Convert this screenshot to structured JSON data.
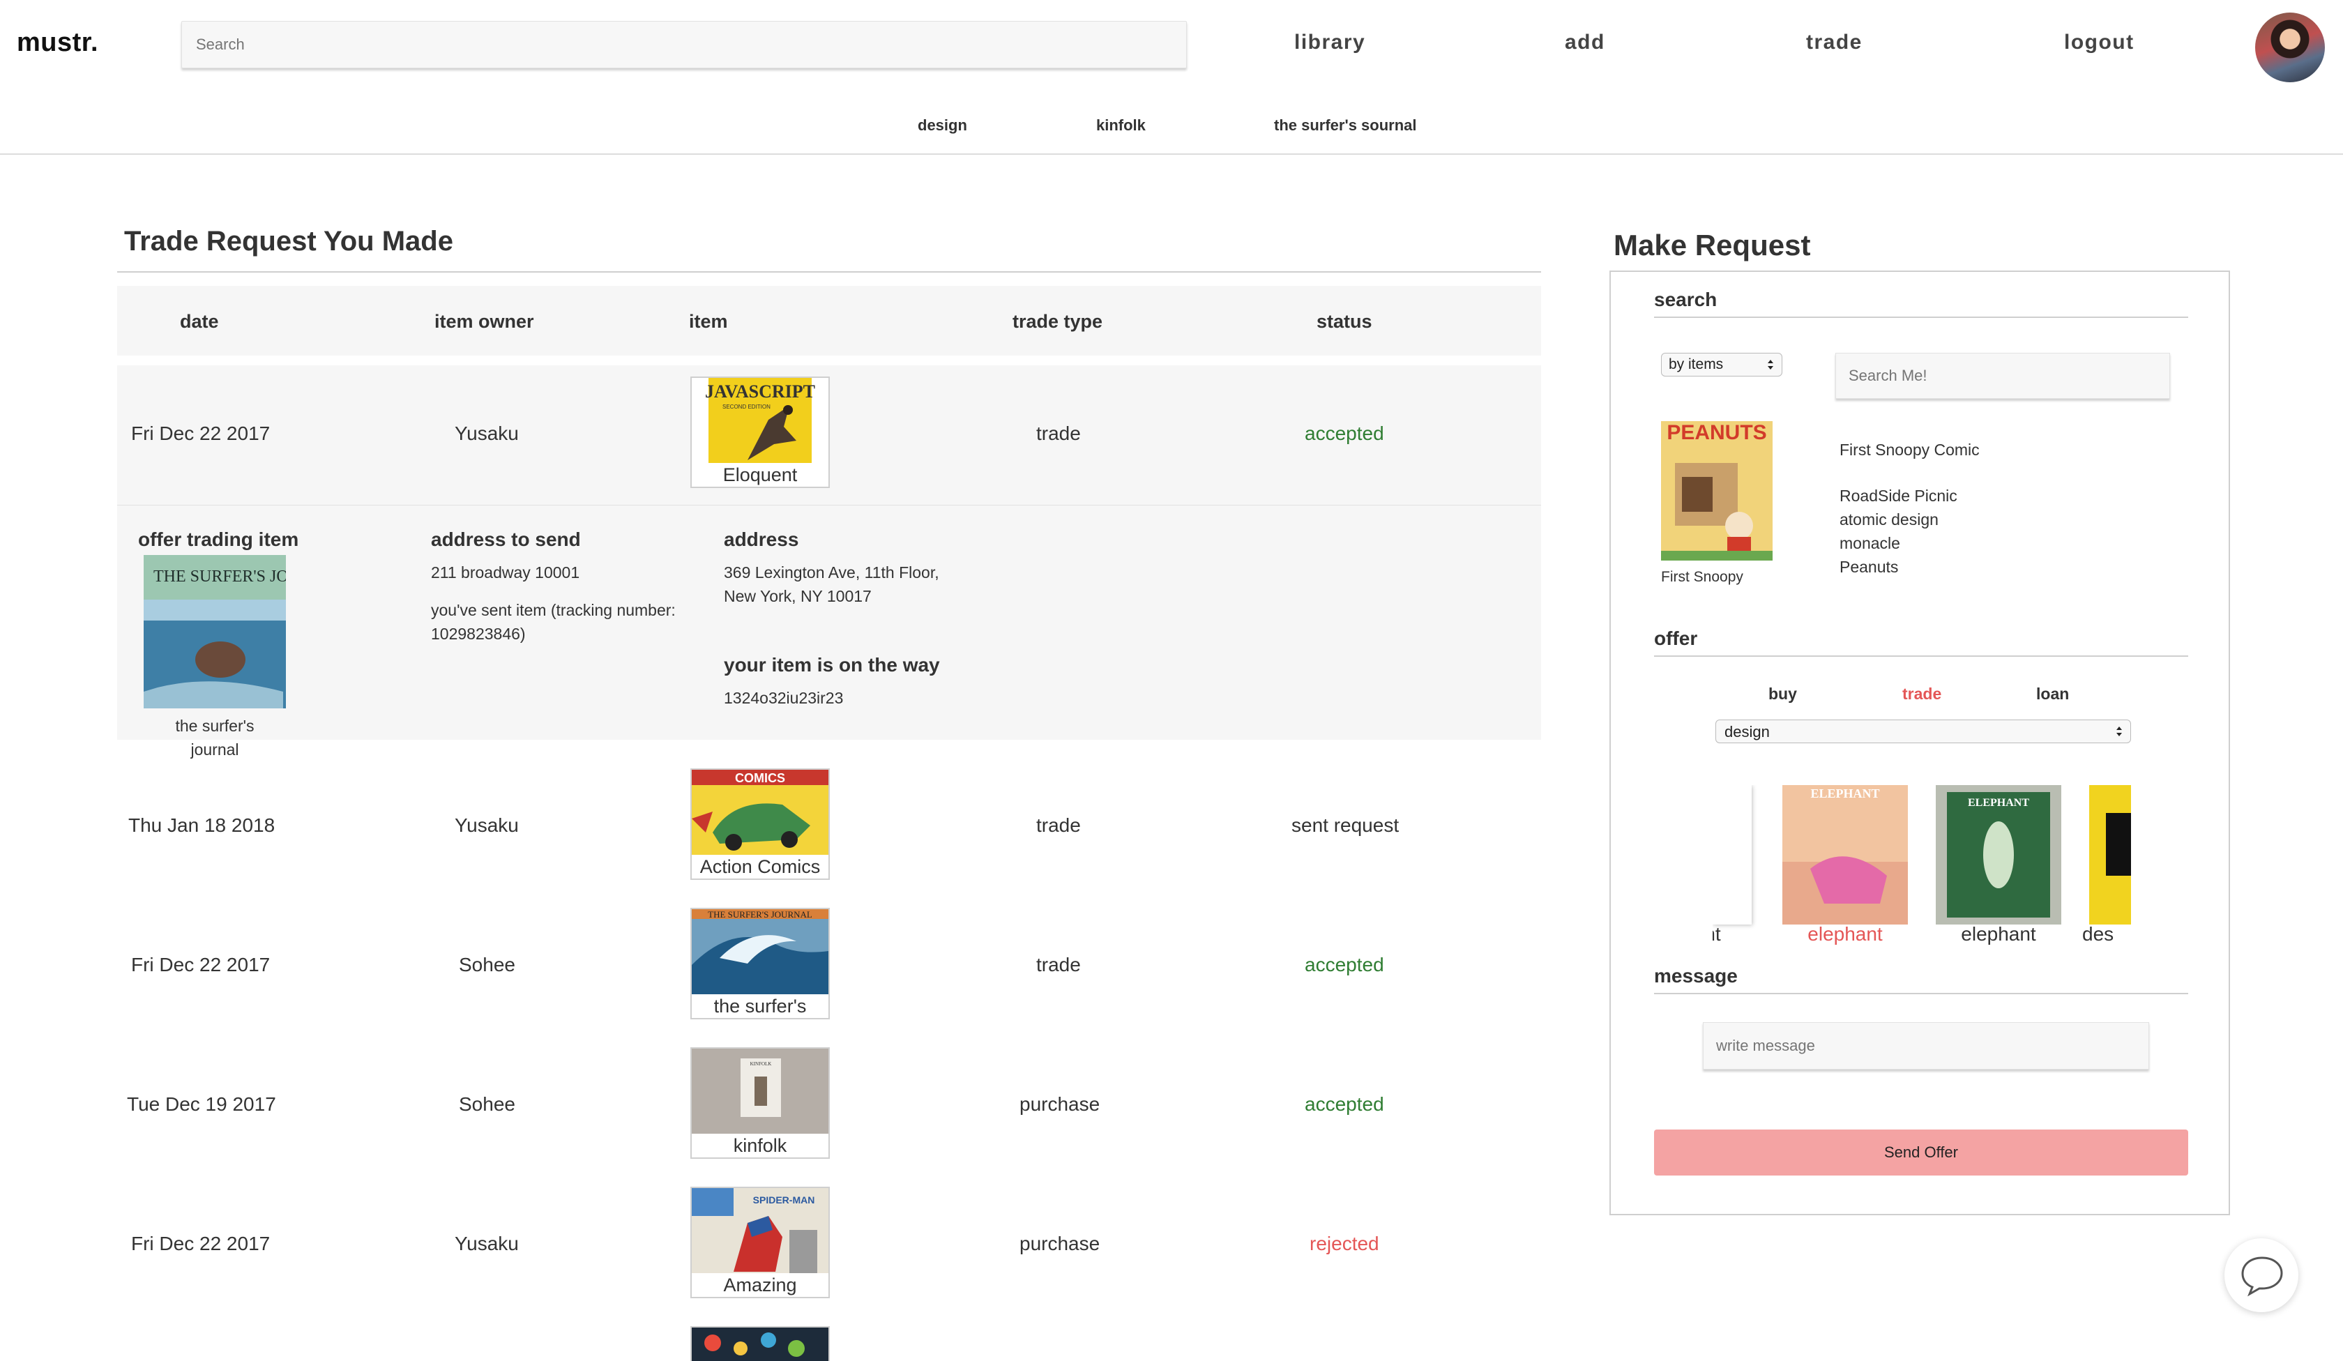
{
  "header": {
    "logo": "mustr.",
    "search_placeholder": "Search",
    "nav": [
      "library",
      "add",
      "trade",
      "logout"
    ]
  },
  "subnav": [
    "design",
    "kinfolk",
    "the surfer's sournal"
  ],
  "trades": {
    "title": "Trade Request You Made",
    "columns": [
      "date",
      "item owner",
      "item",
      "trade type",
      "status"
    ],
    "rows": [
      {
        "date": "Fri Dec 22 2017",
        "owner": "Yusaku",
        "item": "Eloquent",
        "type": "trade",
        "status": "accepted"
      },
      {
        "date": "Thu Jan 18 2018",
        "owner": "Yusaku",
        "item": "Action Comics",
        "type": "trade",
        "status": "sent request"
      },
      {
        "date": "Fri Dec 22 2017",
        "owner": "Sohee",
        "item": "the surfer's",
        "type": "trade",
        "status": "accepted"
      },
      {
        "date": "Tue Dec 19 2017",
        "owner": "Sohee",
        "item": "kinfolk",
        "type": "purchase",
        "status": "accepted"
      },
      {
        "date": "Fri Dec 22 2017",
        "owner": "Yusaku",
        "item": "Amazing",
        "type": "purchase",
        "status": "rejected"
      }
    ],
    "detail": {
      "offer_label": "offer trading item",
      "offer_item_caption": "the surfer's journal",
      "address_to_send_label": "address to send",
      "address_to_send": "211 broadway 10001",
      "sent_note": "you've sent item (tracking number: 1029823846)",
      "address_label": "address",
      "address_line1": "369 Lexington Ave, 11th Floor,",
      "address_line2": "New York, NY 10017",
      "on_the_way_label": "your item is on the way",
      "tracking": "1324o32iu23ir23"
    },
    "cover_texts": {
      "javascript": "JAVASCRIPT",
      "javascript_sub": "SECOND EDITION",
      "surfers": "THE SURFER'S JOURNAL",
      "comics": "COMICS",
      "spider": "SPIDER-MAN",
      "kinfolk": "KINFOLK"
    }
  },
  "make_request": {
    "title": "Make Request",
    "search_label": "search",
    "search_mode": "by items",
    "search_placeholder": "Search Me!",
    "result_caption": "First Snoopy",
    "cover_peanuts": "PEANUTS",
    "results": [
      "First Snoopy Comic",
      "RoadSide Picnic",
      "atomic design",
      "monacle",
      "Peanuts"
    ],
    "offer_label": "offer",
    "offer_tabs": [
      "buy",
      "trade",
      "loan"
    ],
    "active_tab": "trade",
    "category": "design",
    "carousel": [
      "nt",
      "elephant",
      "elephant",
      "des"
    ],
    "carousel_covers": [
      "ELEPHANT",
      "ELEPHANT"
    ],
    "message_label": "message",
    "message_placeholder": "write message",
    "send_label": "Send Offer"
  },
  "colors": {
    "accepted": "#2f7d32",
    "rejected": "#e45656",
    "active_tab": "#e45656",
    "send_button": "#f4a3a3"
  },
  "icons": [
    "chat-bubble-icon",
    "select-arrows-icon"
  ]
}
